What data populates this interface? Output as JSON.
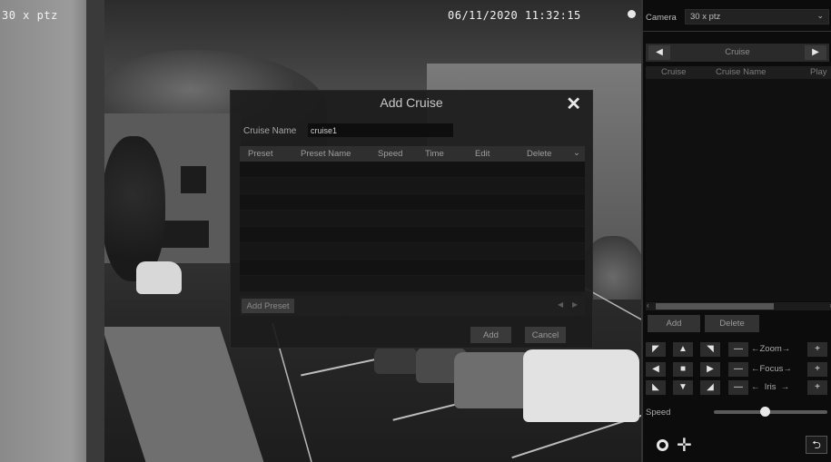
{
  "osd": {
    "camera_label": "30 x ptz",
    "timestamp": "06/11/2020 11:32:15"
  },
  "dialog": {
    "title": "Add Cruise",
    "close_icon": "close-icon",
    "cruise_name_label": "Cruise Name",
    "cruise_name_value": "cruise1",
    "columns": [
      "Preset",
      "Preset Name",
      "Speed",
      "Time",
      "Edit",
      "Delete"
    ],
    "rows": [],
    "add_preset_label": "Add Preset",
    "add_label": "Add",
    "cancel_label": "Cancel"
  },
  "panel": {
    "camera_label": "Camera",
    "camera_value": "30 x ptz",
    "cruise_title": "Cruise",
    "columns": [
      "Cruise",
      "Cruise Name",
      "Play"
    ],
    "add_label": "Add",
    "delete_label": "Delete",
    "zoom_label": "Zoom",
    "focus_label": "Focus",
    "iris_label": "Iris",
    "speed_label": "Speed",
    "speed_level": 0.45
  }
}
